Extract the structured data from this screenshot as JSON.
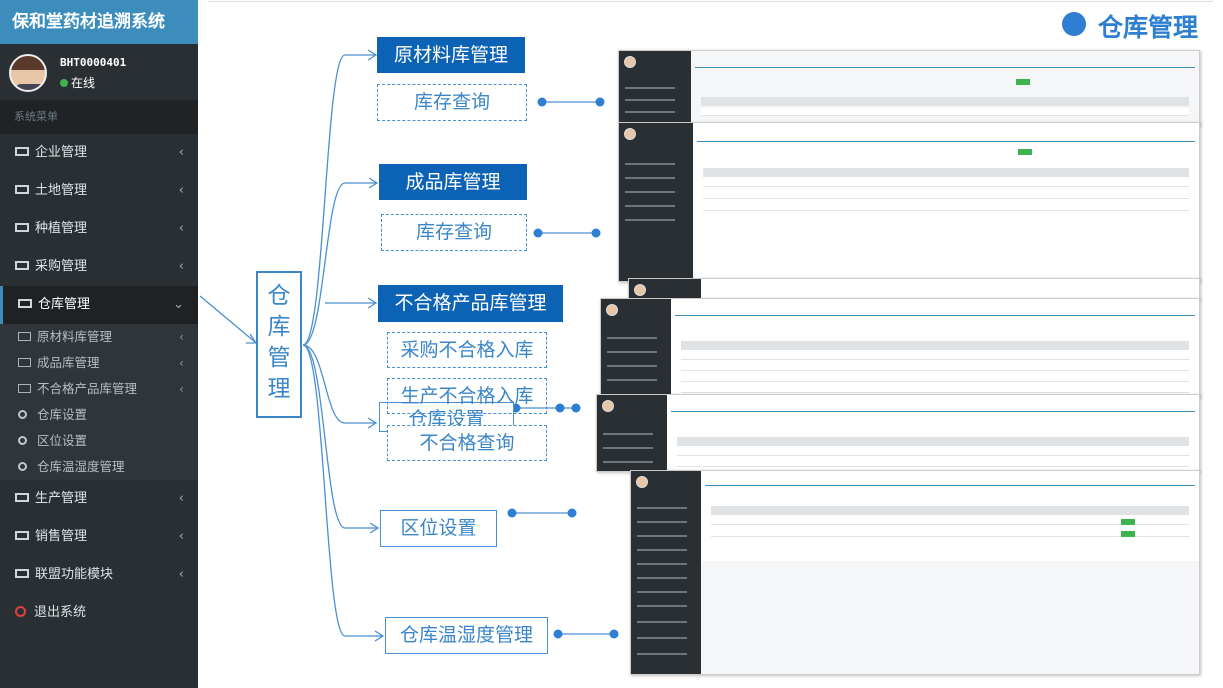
{
  "sidebar": {
    "app_title": "保和堂药材追溯系统",
    "user": {
      "name": "BHT0000401",
      "status": "在线"
    },
    "menu_header": "系统菜单",
    "items": [
      {
        "label": "企业管理",
        "icon": "id-card-icon"
      },
      {
        "label": "土地管理",
        "icon": "id-card-icon"
      },
      {
        "label": "种植管理",
        "icon": "id-card-icon"
      },
      {
        "label": "采购管理",
        "icon": "id-card-icon"
      },
      {
        "label": "仓库管理",
        "icon": "id-card-icon",
        "active": true
      }
    ],
    "sub_items": [
      {
        "label": "原材料库管理",
        "icon": "id-card-icon",
        "expandable": true
      },
      {
        "label": "成品库管理",
        "icon": "id-card-icon",
        "expandable": true
      },
      {
        "label": "不合格产品库管理",
        "icon": "id-card-icon",
        "expandable": true
      },
      {
        "label": "仓库设置",
        "icon": "circle-icon"
      },
      {
        "label": "区位设置",
        "icon": "circle-icon"
      },
      {
        "label": "仓库温湿度管理",
        "icon": "circle-icon"
      }
    ],
    "items_after": [
      {
        "label": "生产管理",
        "icon": "id-card-icon"
      },
      {
        "label": "销售管理",
        "icon": "id-card-icon"
      },
      {
        "label": "联盟功能模块",
        "icon": "id-card-icon"
      }
    ],
    "logout": "退出系统"
  },
  "page_title": "仓库管理",
  "diagram": {
    "center": [
      "仓",
      "库",
      "管",
      "理"
    ],
    "nodes": {
      "raw_material": "原材料库管理",
      "raw_stock_query": "库存查询",
      "finished": "成品库管理",
      "finished_stock_query": "库存查询",
      "unqualified": "不合格产品库管理",
      "purchase_unqualified": "采购不合格入库",
      "production_unqualified": "生产不合格入库",
      "warehouse_settings": "仓库设置",
      "unqualified_query": "不合格查询",
      "zone_settings": "区位设置",
      "temp_humidity": "仓库温湿度管理"
    }
  },
  "colors": {
    "accent": "#3c8dbc",
    "label_blue": "#0c63b5",
    "diagram_blue": "#3a86c8",
    "sidebar_bg": "#2a2f33"
  }
}
